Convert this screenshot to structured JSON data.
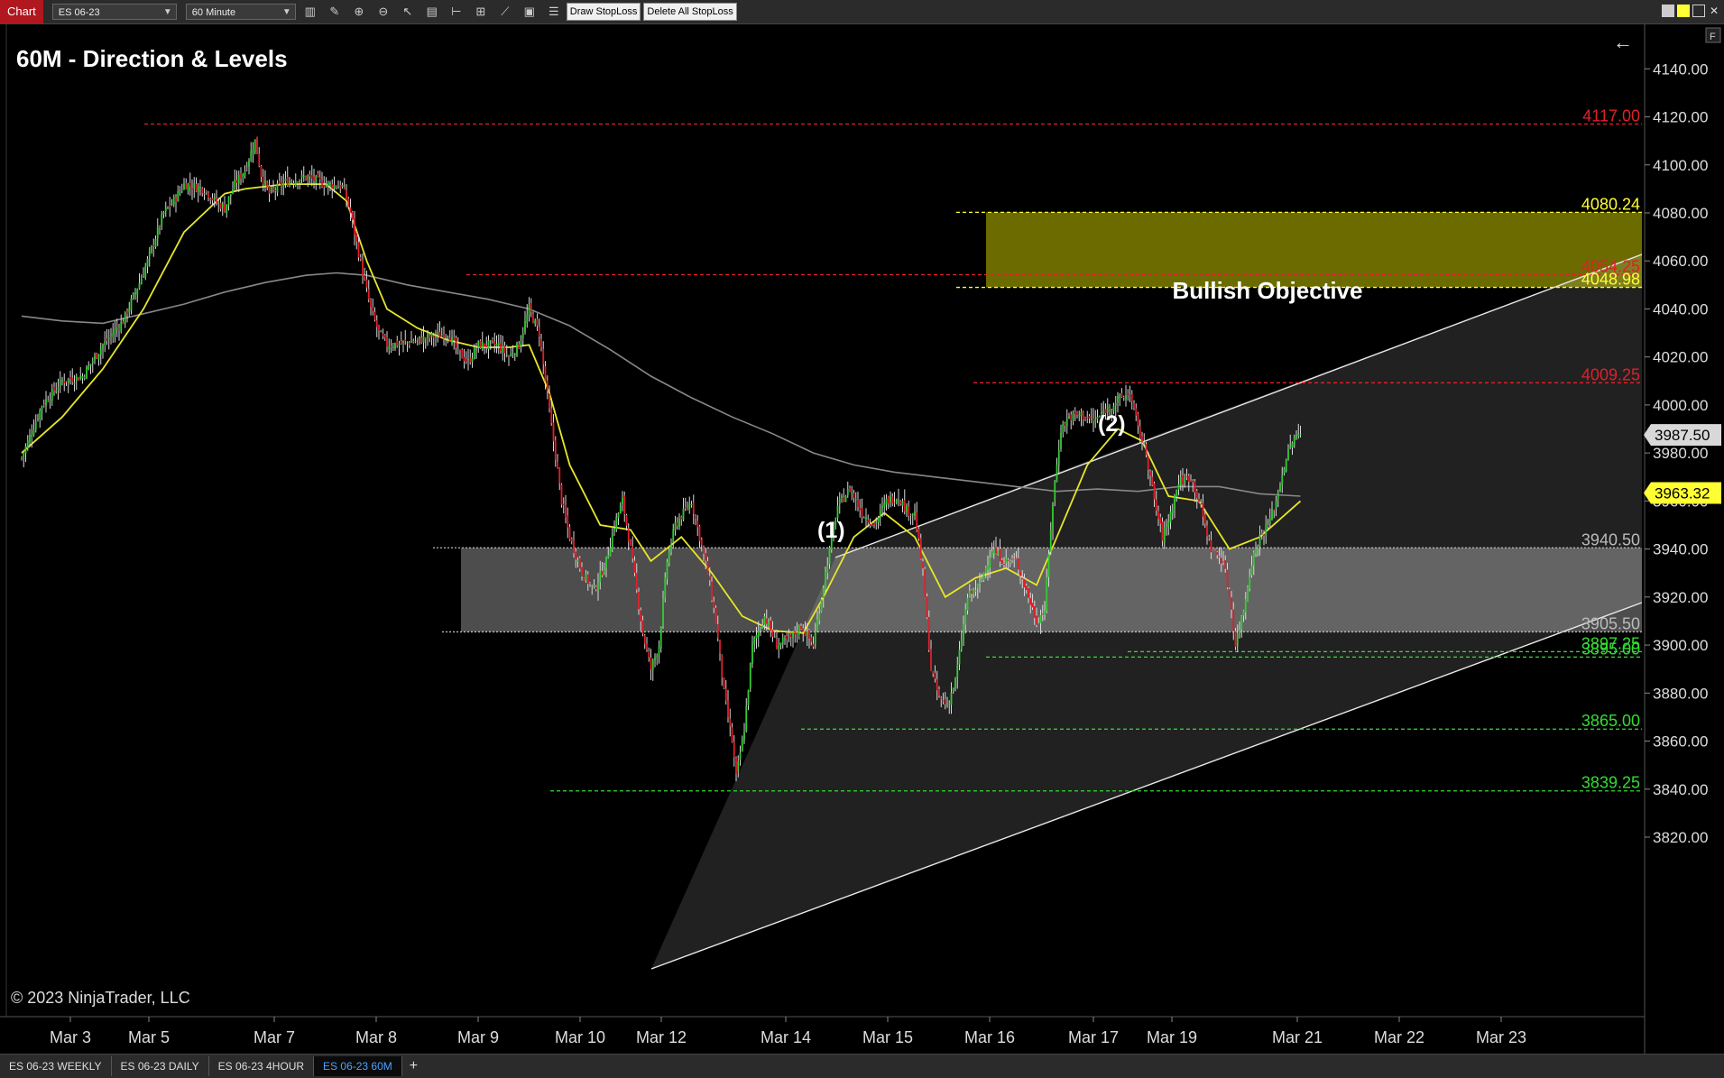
{
  "toolbar": {
    "chart_tab": "Chart",
    "instrument": "ES 06-23",
    "interval": "60 Minute",
    "draw_stoploss": "Draw StopLoss",
    "delete_stoploss": "Delete All StopLoss",
    "icons": [
      "bar-type-icon",
      "pencil-icon",
      "zoom-in-icon",
      "zoom-out-icon",
      "pointer-icon",
      "data-box-icon",
      "indicators-icon",
      "strategies-icon",
      "drawing-tools-icon",
      "properties-icon",
      "list-icon"
    ]
  },
  "chart": {
    "title": "60M - Direction & Levels",
    "copyright": "© 2023 NinjaTrader, LLC",
    "back_arrow": "←",
    "panel_f": "F",
    "wave_1": "(1)",
    "wave_2": "(2)",
    "objective_label": "Bullish Objective"
  },
  "chart_data": {
    "type": "candlestick",
    "instrument": "ES 06-23",
    "interval": "60 Minute",
    "ylim": [
      3812,
      4150
    ],
    "y_ticks": [
      "4140.00",
      "4120.00",
      "4100.00",
      "4080.00",
      "4060.00",
      "4040.00",
      "4020.00",
      "4000.00",
      "3980.00",
      "3960.00",
      "3940.00",
      "3920.00",
      "3900.00",
      "3880.00",
      "3860.00",
      "3840.00",
      "3820.00"
    ],
    "x_ticks": [
      "Mar 3",
      "Mar 5",
      "Mar 7",
      "Mar 8",
      "Mar 9",
      "Mar 10",
      "Mar 12",
      "Mar 14",
      "Mar 15",
      "Mar 16",
      "Mar 17",
      "Mar 19",
      "Mar 21",
      "Mar 22",
      "Mar 23"
    ],
    "last_price": "3987.50",
    "ma_value": "3963.32",
    "levels": [
      {
        "label": "4117.00",
        "value": 4117.0,
        "color": "#e0202a"
      },
      {
        "label": "4080.24",
        "value": 4080.24,
        "color": "#ffff33"
      },
      {
        "label": "4054.25",
        "value": 4054.25,
        "color": "#e0202a"
      },
      {
        "label": "4048.98",
        "value": 4048.98,
        "color": "#ffff33"
      },
      {
        "label": "4009.25",
        "value": 4009.25,
        "color": "#e0202a"
      },
      {
        "label": "3940.50",
        "value": 3940.5,
        "color": "#bbbbbb"
      },
      {
        "label": "3905.50",
        "value": 3905.5,
        "color": "#bbbbbb"
      },
      {
        "label": "3897.25",
        "value": 3897.25,
        "color": "#33dd33"
      },
      {
        "label": "3895.00",
        "value": 3895.0,
        "color": "#33dd33"
      },
      {
        "label": "3865.00",
        "value": 3865.0,
        "color": "#33dd33"
      },
      {
        "label": "3839.25",
        "value": 3839.25,
        "color": "#33dd33"
      }
    ],
    "price_path": [
      [
        0,
        3978
      ],
      [
        10,
        4000
      ],
      [
        20,
        4010
      ],
      [
        30,
        4012
      ],
      [
        40,
        4025
      ],
      [
        50,
        4035
      ],
      [
        60,
        4055
      ],
      [
        70,
        4080
      ],
      [
        75,
        4085
      ],
      [
        80,
        4092
      ],
      [
        90,
        4090
      ],
      [
        95,
        4085
      ],
      [
        100,
        4082
      ],
      [
        105,
        4092
      ],
      [
        110,
        4098
      ],
      [
        115,
        4110
      ],
      [
        118,
        4096
      ],
      [
        122,
        4088
      ],
      [
        130,
        4093
      ],
      [
        140,
        4095
      ],
      [
        150,
        4092
      ],
      [
        158,
        4091
      ],
      [
        162,
        4080
      ],
      [
        168,
        4055
      ],
      [
        172,
        4040
      ],
      [
        176,
        4030
      ],
      [
        180,
        4025
      ],
      [
        190,
        4026
      ],
      [
        200,
        4028
      ],
      [
        210,
        4030
      ],
      [
        215,
        4022
      ],
      [
        220,
        4018
      ],
      [
        225,
        4025
      ],
      [
        235,
        4025
      ],
      [
        240,
        4020
      ],
      [
        245,
        4025
      ],
      [
        250,
        4040
      ],
      [
        255,
        4030
      ],
      [
        258,
        4010
      ],
      [
        262,
        3985
      ],
      [
        266,
        3960
      ],
      [
        270,
        3945
      ],
      [
        276,
        3930
      ],
      [
        282,
        3923
      ],
      [
        288,
        3935
      ],
      [
        292,
        3950
      ],
      [
        296,
        3960
      ],
      [
        300,
        3940
      ],
      [
        306,
        3905
      ],
      [
        310,
        3890
      ],
      [
        314,
        3900
      ],
      [
        318,
        3935
      ],
      [
        322,
        3950
      ],
      [
        326,
        3955
      ],
      [
        330,
        3960
      ],
      [
        334,
        3945
      ],
      [
        338,
        3930
      ],
      [
        342,
        3910
      ],
      [
        344,
        3895
      ],
      [
        346,
        3880
      ],
      [
        350,
        3860
      ],
      [
        352,
        3845
      ],
      [
        356,
        3865
      ],
      [
        360,
        3900
      ],
      [
        366,
        3912
      ],
      [
        372,
        3900
      ],
      [
        378,
        3902
      ],
      [
        384,
        3908
      ],
      [
        390,
        3900
      ],
      [
        396,
        3930
      ],
      [
        402,
        3958
      ],
      [
        408,
        3965
      ],
      [
        414,
        3955
      ],
      [
        420,
        3950
      ],
      [
        426,
        3960
      ],
      [
        432,
        3962
      ],
      [
        436,
        3956
      ],
      [
        440,
        3955
      ],
      [
        444,
        3930
      ],
      [
        448,
        3890
      ],
      [
        452,
        3878
      ],
      [
        456,
        3875
      ],
      [
        460,
        3885
      ],
      [
        466,
        3920
      ],
      [
        472,
        3925
      ],
      [
        478,
        3940
      ],
      [
        484,
        3935
      ],
      [
        490,
        3935
      ],
      [
        496,
        3920
      ],
      [
        500,
        3910
      ],
      [
        504,
        3915
      ],
      [
        508,
        3960
      ],
      [
        512,
        3990
      ],
      [
        516,
        3995
      ],
      [
        522,
        3996
      ],
      [
        528,
        3993
      ],
      [
        534,
        3998
      ],
      [
        540,
        4002
      ],
      [
        546,
        4005
      ],
      [
        550,
        3990
      ],
      [
        554,
        3980
      ],
      [
        558,
        3960
      ],
      [
        562,
        3945
      ],
      [
        566,
        3955
      ],
      [
        570,
        3968
      ],
      [
        576,
        3970
      ],
      [
        580,
        3960
      ],
      [
        586,
        3940
      ],
      [
        592,
        3935
      ],
      [
        596,
        3915
      ],
      [
        598,
        3900
      ],
      [
        602,
        3915
      ],
      [
        606,
        3935
      ],
      [
        610,
        3945
      ],
      [
        614,
        3950
      ],
      [
        618,
        3960
      ],
      [
        622,
        3975
      ],
      [
        626,
        3985
      ],
      [
        630,
        3988
      ]
    ],
    "ma_fast_path": [
      [
        0,
        3980
      ],
      [
        20,
        3995
      ],
      [
        40,
        4015
      ],
      [
        60,
        4040
      ],
      [
        80,
        4072
      ],
      [
        100,
        4088
      ],
      [
        110,
        4090
      ],
      [
        130,
        4092
      ],
      [
        150,
        4092
      ],
      [
        160,
        4085
      ],
      [
        170,
        4060
      ],
      [
        180,
        4040
      ],
      [
        195,
        4032
      ],
      [
        210,
        4027
      ],
      [
        225,
        4024
      ],
      [
        240,
        4024
      ],
      [
        250,
        4025
      ],
      [
        260,
        4005
      ],
      [
        270,
        3975
      ],
      [
        285,
        3950
      ],
      [
        300,
        3948
      ],
      [
        310,
        3935
      ],
      [
        325,
        3945
      ],
      [
        340,
        3930
      ],
      [
        355,
        3912
      ],
      [
        370,
        3906
      ],
      [
        385,
        3905
      ],
      [
        395,
        3920
      ],
      [
        410,
        3945
      ],
      [
        425,
        3955
      ],
      [
        440,
        3945
      ],
      [
        455,
        3920
      ],
      [
        470,
        3928
      ],
      [
        485,
        3932
      ],
      [
        500,
        3925
      ],
      [
        510,
        3945
      ],
      [
        525,
        3975
      ],
      [
        540,
        3990
      ],
      [
        552,
        3985
      ],
      [
        565,
        3962
      ],
      [
        580,
        3960
      ],
      [
        595,
        3940
      ],
      [
        610,
        3945
      ],
      [
        630,
        3960
      ]
    ],
    "ma_slow_path": [
      [
        0,
        4037
      ],
      [
        20,
        4035
      ],
      [
        40,
        4034
      ],
      [
        60,
        4038
      ],
      [
        80,
        4042
      ],
      [
        100,
        4047
      ],
      [
        120,
        4051
      ],
      [
        140,
        4054
      ],
      [
        155,
        4055
      ],
      [
        170,
        4054
      ],
      [
        190,
        4050
      ],
      [
        210,
        4047
      ],
      [
        230,
        4044
      ],
      [
        250,
        4040
      ],
      [
        270,
        4033
      ],
      [
        290,
        4023
      ],
      [
        310,
        4012
      ],
      [
        330,
        4003
      ],
      [
        350,
        3995
      ],
      [
        370,
        3988
      ],
      [
        390,
        3980
      ],
      [
        410,
        3975
      ],
      [
        430,
        3972
      ],
      [
        450,
        3970
      ],
      [
        470,
        3968
      ],
      [
        490,
        3966
      ],
      [
        510,
        3964
      ],
      [
        530,
        3965
      ],
      [
        550,
        3964
      ],
      [
        570,
        3966
      ],
      [
        590,
        3966
      ],
      [
        610,
        3963
      ],
      [
        630,
        3962
      ]
    ],
    "objective_zone": [
      4048.98,
      4080.24
    ],
    "support_zone": [
      3905.5,
      3940.5
    ],
    "channel_lower": [
      [
        3839.25,
        0
      ],
      [
        4015,
        0
      ]
    ],
    "wave_peaks": {
      "w1": 3972,
      "w2": 4009.25
    }
  },
  "bottom_tabs": [
    "ES 06-23 WEEKLY",
    "ES 06-23 DAILY",
    "ES 06-23 4HOUR",
    "ES 06-23 60M"
  ],
  "bottom_add": "+",
  "colors": {
    "up": "#33cc33",
    "down": "#e0202a",
    "ma_fast": "#e6e62a",
    "ma_slow": "#888888",
    "objective": "#6b6b00",
    "support_band": "#5a5a5a"
  }
}
